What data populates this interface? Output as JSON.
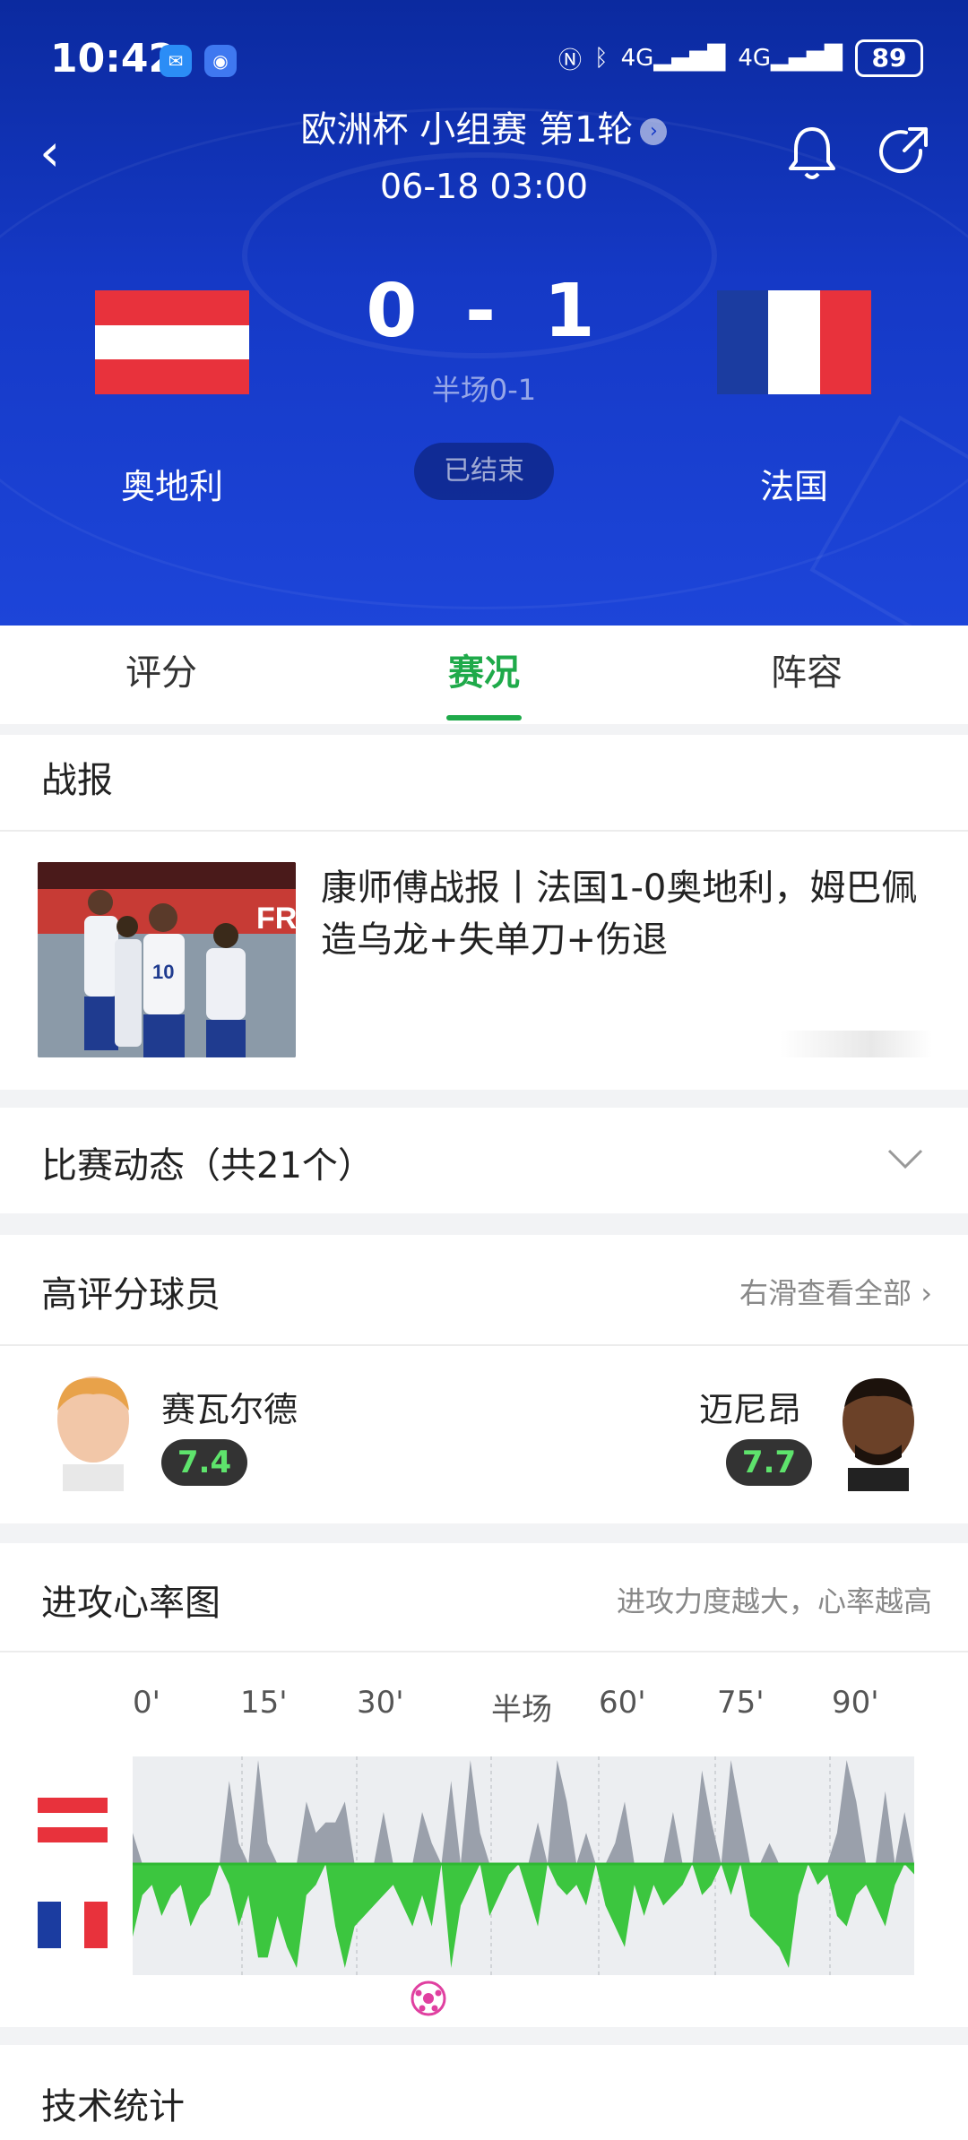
{
  "status_bar": {
    "time": "10:42",
    "battery": "89",
    "signal_1": "4G",
    "signal_2": "4G"
  },
  "match": {
    "title": "欧洲杯 小组赛 第1轮",
    "kickoff": "06-18 03:00",
    "home_team": "奥地利",
    "away_team": "法国",
    "home_score": "0",
    "away_score": "1",
    "score_sep": "-",
    "halftime": "半场0-1",
    "status": "已结束"
  },
  "colors": {
    "header_blue": "#1539c6",
    "accent_green": "#1faa4a",
    "austria_red": "#e8323c",
    "france_blue": "#1b3ca0"
  },
  "tabs": [
    {
      "label": "评分",
      "active": false
    },
    {
      "label": "赛况",
      "active": true
    },
    {
      "label": "阵容",
      "active": false
    }
  ],
  "report": {
    "section_title": "战报",
    "headline": "康师傅战报丨法国1-0奥地利，姆巴佩造乌龙+失单刀+伤退",
    "thumb_number": "10"
  },
  "events": {
    "title": "比赛动态（共21个）",
    "icon": "chevron-down-icon"
  },
  "top_players": {
    "title": "高评分球员",
    "more_label": "右滑查看全部",
    "home": {
      "name": "赛瓦尔德",
      "rating": "7.4"
    },
    "away": {
      "name": "迈尼昂",
      "rating": "7.7"
    }
  },
  "momentum": {
    "title": "进攻心率图",
    "subtitle": "进攻力度越大，心率越高",
    "ticks": [
      "0'",
      "15'",
      "30'",
      "半场",
      "60'",
      "75'",
      "90'"
    ]
  },
  "chart_data": {
    "type": "area",
    "series": [
      {
        "values": [
          0.3,
          0,
          0,
          0,
          0,
          0,
          0,
          0,
          0,
          0,
          0.8,
          0.2,
          0,
          1,
          0.2,
          0,
          0,
          0,
          0.6,
          0.3,
          0.4,
          0.4,
          0.6,
          0,
          0,
          0,
          0.5,
          0,
          0,
          0,
          0.5,
          0.2,
          0,
          0.8,
          0,
          1,
          0.3,
          0,
          0,
          0,
          0,
          0,
          0.4,
          0,
          1,
          0.6,
          0,
          0.3,
          0,
          0,
          0.2,
          0.6,
          0,
          0,
          0,
          0,
          0.5,
          0,
          0,
          0.9,
          0.4,
          0,
          1,
          0.5,
          0,
          0,
          0.2,
          0,
          0,
          0,
          0,
          0,
          0,
          0.3,
          1,
          0.6,
          0,
          0,
          0.7,
          0,
          0.5,
          0
        ]
      },
      {
        "values": [
          0.7,
          0.3,
          0.2,
          0.5,
          0.3,
          0.2,
          0.6,
          0.4,
          0.3,
          0,
          0.2,
          0.6,
          0.3,
          0.9,
          0.9,
          0.5,
          0.8,
          1,
          0.3,
          0.2,
          0,
          0.6,
          1,
          0.6,
          0.5,
          0.4,
          0.3,
          0.2,
          0.4,
          0.6,
          0.3,
          0.6,
          0,
          1,
          0.4,
          0.2,
          0,
          0.5,
          0.3,
          0.1,
          0,
          0.3,
          0.6,
          0,
          0.2,
          0.3,
          0.2,
          0.4,
          0,
          0.4,
          0.6,
          0.8,
          0.2,
          0.5,
          0.2,
          0.4,
          0.3,
          0.2,
          0,
          0.3,
          0.2,
          0,
          0.3,
          0,
          0.5,
          0.6,
          0.7,
          0.8,
          1,
          0.3,
          0,
          0.2,
          0.1,
          0.5,
          0.6,
          0.3,
          0.2,
          0.4,
          0.6,
          0.2,
          0,
          0.1
        ]
      }
    ],
    "x_ticks": [
      "0'",
      "15'",
      "30'",
      "半场",
      "60'",
      "75'",
      "90'"
    ],
    "goal_marker_minute": 38
  },
  "tech_stats": {
    "title": "技术统计"
  }
}
